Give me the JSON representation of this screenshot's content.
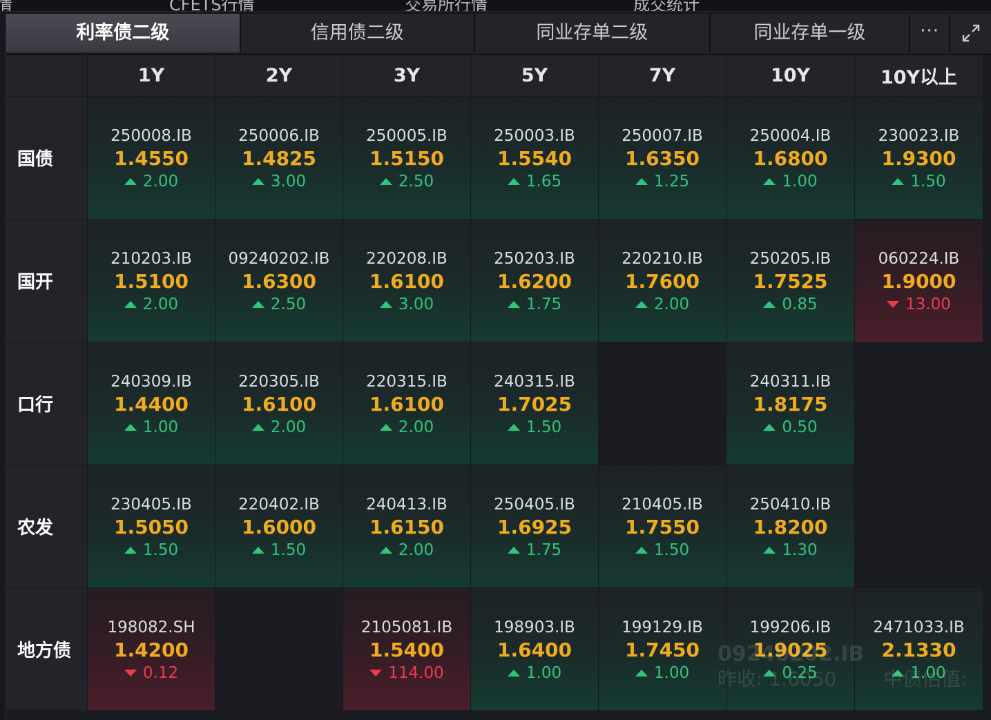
{
  "top_strip": [
    "情",
    "CFETS行情",
    "交易所行情",
    "成交统计"
  ],
  "tabs": [
    {
      "label": "利率债二级",
      "active": true
    },
    {
      "label": "信用债二级",
      "active": false
    },
    {
      "label": "同业存单二级",
      "active": false
    },
    {
      "label": "同业存单一级",
      "active": false
    }
  ],
  "more_label": "···",
  "columns": [
    "1Y",
    "2Y",
    "3Y",
    "5Y",
    "7Y",
    "10Y",
    "10Y以上"
  ],
  "rows": [
    {
      "label": "国债",
      "cells": [
        {
          "code": "250008.IB",
          "yield": "1.4550",
          "change": "2.00",
          "dir": "up"
        },
        {
          "code": "250006.IB",
          "yield": "1.4825",
          "change": "3.00",
          "dir": "up"
        },
        {
          "code": "250005.IB",
          "yield": "1.5150",
          "change": "2.50",
          "dir": "up"
        },
        {
          "code": "250003.IB",
          "yield": "1.5540",
          "change": "1.65",
          "dir": "up"
        },
        {
          "code": "250007.IB",
          "yield": "1.6350",
          "change": "1.25",
          "dir": "up"
        },
        {
          "code": "250004.IB",
          "yield": "1.6800",
          "change": "1.00",
          "dir": "up"
        },
        {
          "code": "230023.IB",
          "yield": "1.9300",
          "change": "1.50",
          "dir": "up"
        }
      ]
    },
    {
      "label": "国开",
      "cells": [
        {
          "code": "210203.IB",
          "yield": "1.5100",
          "change": "2.00",
          "dir": "up"
        },
        {
          "code": "09240202.IB",
          "yield": "1.6300",
          "change": "2.50",
          "dir": "up"
        },
        {
          "code": "220208.IB",
          "yield": "1.6100",
          "change": "3.00",
          "dir": "up"
        },
        {
          "code": "250203.IB",
          "yield": "1.6200",
          "change": "1.75",
          "dir": "up"
        },
        {
          "code": "220210.IB",
          "yield": "1.7600",
          "change": "2.00",
          "dir": "up"
        },
        {
          "code": "250205.IB",
          "yield": "1.7525",
          "change": "0.85",
          "dir": "up"
        },
        {
          "code": "060224.IB",
          "yield": "1.9000",
          "change": "13.00",
          "dir": "down"
        }
      ]
    },
    {
      "label": "口行",
      "cells": [
        {
          "code": "240309.IB",
          "yield": "1.4400",
          "change": "1.00",
          "dir": "up"
        },
        {
          "code": "220305.IB",
          "yield": "1.6100",
          "change": "2.00",
          "dir": "up"
        },
        {
          "code": "220315.IB",
          "yield": "1.6100",
          "change": "2.00",
          "dir": "up"
        },
        {
          "code": "240315.IB",
          "yield": "1.7025",
          "change": "1.50",
          "dir": "up"
        },
        null,
        {
          "code": "240311.IB",
          "yield": "1.8175",
          "change": "0.50",
          "dir": "up"
        },
        null
      ]
    },
    {
      "label": "农发",
      "cells": [
        {
          "code": "230405.IB",
          "yield": "1.5050",
          "change": "1.50",
          "dir": "up"
        },
        {
          "code": "220402.IB",
          "yield": "1.6000",
          "change": "1.50",
          "dir": "up"
        },
        {
          "code": "240413.IB",
          "yield": "1.6150",
          "change": "2.00",
          "dir": "up"
        },
        {
          "code": "250405.IB",
          "yield": "1.6925",
          "change": "1.75",
          "dir": "up"
        },
        {
          "code": "210405.IB",
          "yield": "1.7550",
          "change": "1.50",
          "dir": "up"
        },
        {
          "code": "250410.IB",
          "yield": "1.8200",
          "change": "1.30",
          "dir": "up"
        },
        null
      ]
    },
    {
      "label": "地方债",
      "cells": [
        {
          "code": "198082.SH",
          "yield": "1.4200",
          "change": "0.12",
          "dir": "down"
        },
        null,
        {
          "code": "2105081.IB",
          "yield": "1.5400",
          "change": "114.00",
          "dir": "down"
        },
        {
          "code": "198903.IB",
          "yield": "1.6400",
          "change": "1.00",
          "dir": "up"
        },
        {
          "code": "199129.IB",
          "yield": "1.7450",
          "change": "1.00",
          "dir": "up"
        },
        {
          "code": "199206.IB",
          "yield": "1.9025",
          "change": "0.25",
          "dir": "up"
        },
        {
          "code": "2471033.IB",
          "yield": "2.1330",
          "change": "1.00",
          "dir": "up"
        }
      ]
    }
  ],
  "ghost_tooltip": {
    "code": "09240202.IB",
    "prev_close": "昨收: 1.6050",
    "valuation_label": "中债估值:"
  },
  "colors": {
    "yield": "#f0ab1e",
    "up": "#2fc57e",
    "down": "#ef3b4f"
  }
}
